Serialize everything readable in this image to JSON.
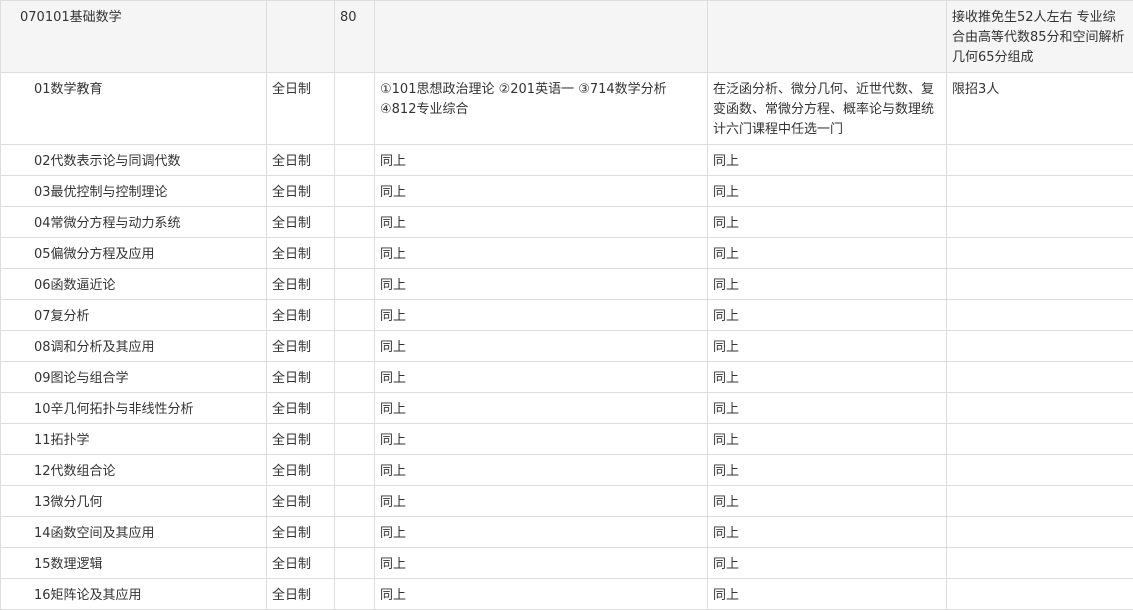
{
  "major": {
    "name": "070101基础数学",
    "study_mode": "",
    "enrollment": "80",
    "exam_subjects": "",
    "retest_subjects": "",
    "remarks": "接收推免生52人左右 专业综合由高等代数85分和空间解析几何65分组成"
  },
  "directions": [
    {
      "name": "01数学教育",
      "mode": "全日制",
      "exam": "①101思想政治理论 ②201英语一 ③714数学分析 ④812专业综合",
      "retest": "在泛函分析、微分几何、近世代数、复变函数、常微分方程、概率论与数理统计六门课程中任选一门",
      "remarks": "限招3人"
    },
    {
      "name": "02代数表示论与同调代数",
      "mode": "全日制",
      "exam": "同上",
      "retest": "同上",
      "remarks": ""
    },
    {
      "name": "03最优控制与控制理论",
      "mode": "全日制",
      "exam": "同上",
      "retest": "同上",
      "remarks": ""
    },
    {
      "name": "04常微分方程与动力系统",
      "mode": "全日制",
      "exam": "同上",
      "retest": "同上",
      "remarks": ""
    },
    {
      "name": "05偏微分方程及应用",
      "mode": "全日制",
      "exam": "同上",
      "retest": "同上",
      "remarks": ""
    },
    {
      "name": "06函数逼近论",
      "mode": "全日制",
      "exam": "同上",
      "retest": "同上",
      "remarks": ""
    },
    {
      "name": "07复分析",
      "mode": "全日制",
      "exam": "同上",
      "retest": "同上",
      "remarks": ""
    },
    {
      "name": "08调和分析及其应用",
      "mode": "全日制",
      "exam": "同上",
      "retest": "同上",
      "remarks": ""
    },
    {
      "name": "09图论与组合学",
      "mode": "全日制",
      "exam": "同上",
      "retest": "同上",
      "remarks": ""
    },
    {
      "name": "10辛几何拓扑与非线性分析",
      "mode": "全日制",
      "exam": "同上",
      "retest": "同上",
      "remarks": ""
    },
    {
      "name": "11拓扑学",
      "mode": "全日制",
      "exam": "同上",
      "retest": "同上",
      "remarks": ""
    },
    {
      "name": "12代数组合论",
      "mode": "全日制",
      "exam": "同上",
      "retest": "同上",
      "remarks": ""
    },
    {
      "name": "13微分几何",
      "mode": "全日制",
      "exam": "同上",
      "retest": "同上",
      "remarks": ""
    },
    {
      "name": "14函数空间及其应用",
      "mode": "全日制",
      "exam": "同上",
      "retest": "同上",
      "remarks": ""
    },
    {
      "name": "15数理逻辑",
      "mode": "全日制",
      "exam": "同上",
      "retest": "同上",
      "remarks": ""
    },
    {
      "name": "16矩阵论及其应用",
      "mode": "全日制",
      "exam": "同上",
      "retest": "同上",
      "remarks": ""
    }
  ]
}
